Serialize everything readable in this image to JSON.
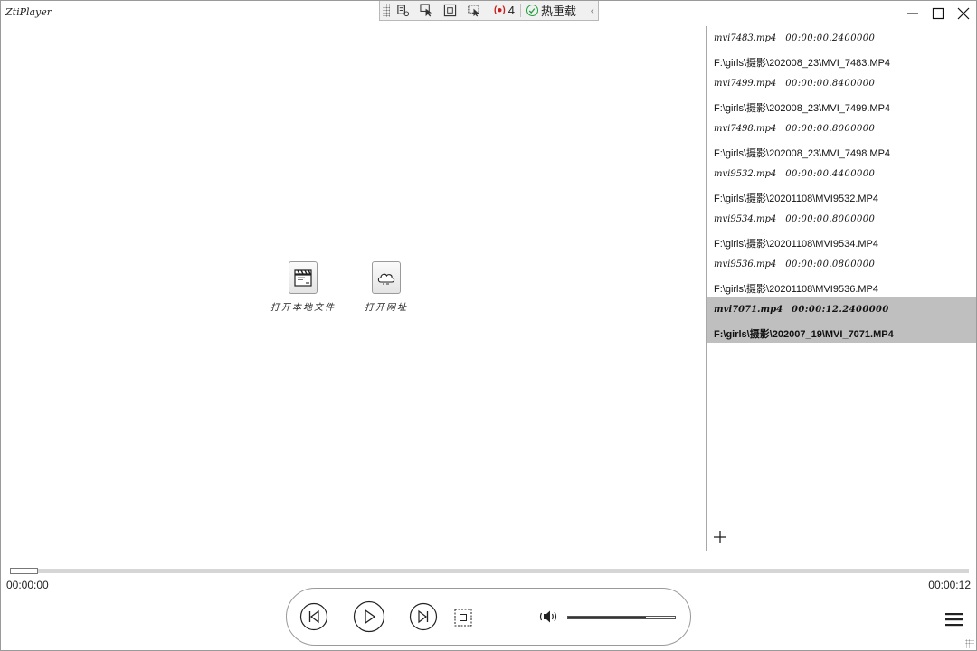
{
  "window": {
    "title": "ZtiPlayer"
  },
  "debug_toolbar": {
    "record_count": "4",
    "hot_reload_label": "热重载"
  },
  "center": {
    "open_local_label": "打开本地文件",
    "open_url_label": "打开网址"
  },
  "playlist": {
    "items": [
      {
        "name": "mvi7483.mp4",
        "duration": "00:00:00.2400000",
        "path": "F:\\girls\\摄影\\202008_23\\MVI_7483.MP4",
        "selected": false
      },
      {
        "name": "mvi7499.mp4",
        "duration": "00:00:00.8400000",
        "path": "F:\\girls\\摄影\\202008_23\\MVI_7499.MP4",
        "selected": false
      },
      {
        "name": "mvi7498.mp4",
        "duration": "00:00:00.8000000",
        "path": "F:\\girls\\摄影\\202008_23\\MVI_7498.MP4",
        "selected": false
      },
      {
        "name": "mvi9532.mp4",
        "duration": "00:00:00.4400000",
        "path": "F:\\girls\\摄影\\20201108\\MVI9532.MP4",
        "selected": false
      },
      {
        "name": "mvi9534.mp4",
        "duration": "00:00:00.8000000",
        "path": "F:\\girls\\摄影\\20201108\\MVI9534.MP4",
        "selected": false
      },
      {
        "name": "mvi9536.mp4",
        "duration": "00:00:00.0800000",
        "path": "F:\\girls\\摄影\\20201108\\MVI9536.MP4",
        "selected": false
      },
      {
        "name": "mvi7071.mp4",
        "duration": "00:00:12.2400000",
        "path": "F:\\girls\\摄影\\202007_19\\MVI_7071.MP4",
        "selected": true
      }
    ]
  },
  "playback": {
    "current_time": "00:00:00",
    "total_time": "00:00:12",
    "progress_fraction": 0.0,
    "volume_fraction": 0.73
  },
  "icons": {
    "minimize": "minimize-icon",
    "maximize": "maximize-icon",
    "close": "close-icon",
    "prev": "skip-previous-icon",
    "play": "play-icon",
    "next": "skip-next-icon",
    "stop": "stop-icon",
    "volume": "volume-icon",
    "add": "plus-icon",
    "menu": "hamburger-menu-icon",
    "open_local": "clapperboard-icon",
    "open_url": "cloud-icon"
  },
  "colors": {
    "selected_row": "#bfbfbf",
    "border": "#9a9a9a",
    "record": "#c81e1e",
    "check": "#1f9d3a"
  }
}
